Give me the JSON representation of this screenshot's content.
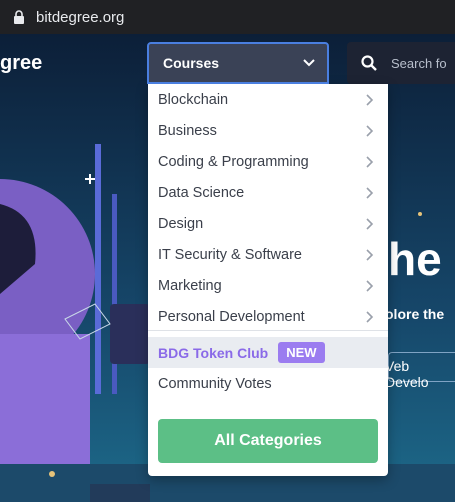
{
  "browser": {
    "url": "bitdegree.org"
  },
  "site": {
    "logo_text": "gree"
  },
  "nav": {
    "courses_label": "Courses",
    "search_placeholder": "Search fo"
  },
  "dropdown": {
    "items": [
      {
        "label": "Blockchain"
      },
      {
        "label": "Business"
      },
      {
        "label": "Coding & Programming"
      },
      {
        "label": "Data Science"
      },
      {
        "label": "Design"
      },
      {
        "label": "IT Security & Software"
      },
      {
        "label": "Marketing"
      },
      {
        "label": "Personal Development"
      }
    ],
    "token_club": {
      "label": "BDG Token Club",
      "badge": "NEW"
    },
    "community_votes": "Community Votes",
    "all_categories": "All Categories"
  },
  "hero": {
    "big_text": "he",
    "sub_text": "olore the",
    "tag_text": "Veb Develo"
  },
  "colors": {
    "accent_green": "#5cbf86",
    "token_purple": "#9b7cf0",
    "nav_dark": "#3a4256"
  }
}
